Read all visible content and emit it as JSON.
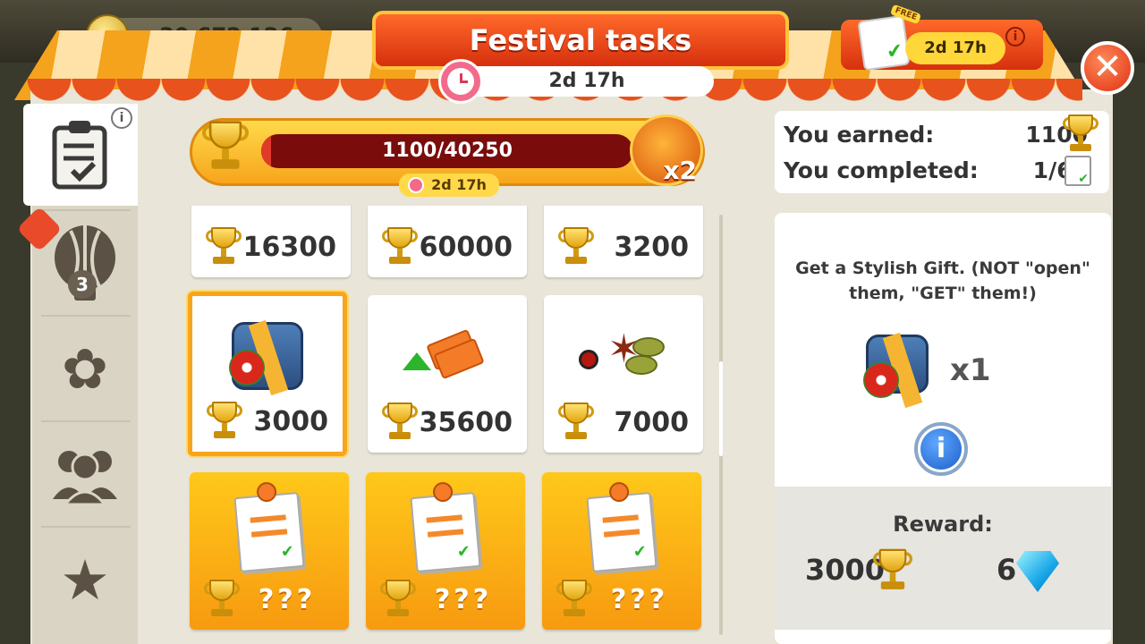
{
  "top_bar": {
    "coins": "30 672 126",
    "coin_icon": "coin-icon"
  },
  "header": {
    "title": "Festival tasks",
    "timer": "2d 17h"
  },
  "free_pass": {
    "badge": "FREE",
    "timer": "2d 17h",
    "info_icon": "info-icon",
    "close_icon": "close-icon"
  },
  "sidebar": {
    "tabs": [
      {
        "name": "tasks",
        "icon": "clipboard-icon",
        "glyph": "📋",
        "active": true,
        "info": "i"
      },
      {
        "name": "balloons",
        "icon": "balloon-icon",
        "glyph": "🎈",
        "badge": "3"
      },
      {
        "name": "flower",
        "icon": "pinwheel-icon",
        "glyph": "✿"
      },
      {
        "name": "friends",
        "icon": "people-icon",
        "glyph": "👥"
      },
      {
        "name": "rating",
        "icon": "star-wreath-icon",
        "glyph": "★"
      }
    ]
  },
  "progress": {
    "current": 1100,
    "goal": 40250,
    "text": "1100/40250",
    "timer": "2d 17h",
    "multiplier": "x2",
    "fill_fraction": 0.027
  },
  "tasks": {
    "rows": [
      [
        {
          "reward": "16300",
          "art": "none",
          "state": "normal"
        },
        {
          "reward": "60000",
          "art": "none",
          "state": "normal"
        },
        {
          "reward": "3200",
          "art": "none",
          "state": "normal"
        }
      ],
      [
        {
          "reward": "3000",
          "art": "stylish-gift",
          "state": "selected"
        },
        {
          "reward": "35600",
          "art": "tickets",
          "state": "normal"
        },
        {
          "reward": "7000",
          "art": "spices",
          "state": "normal"
        }
      ],
      [
        {
          "reward": "???",
          "art": "task-note",
          "state": "locked"
        },
        {
          "reward": "???",
          "art": "task-note",
          "state": "locked"
        },
        {
          "reward": "???",
          "art": "task-note",
          "state": "locked"
        }
      ]
    ]
  },
  "stats": {
    "earned_label": "You earned:",
    "earned_value": "1100",
    "completed_label": "You completed:",
    "completed_value": "1/60"
  },
  "detail": {
    "description": "Get a Stylish Gift. (NOT \"open\" them, \"GET\" them!)",
    "quantity": "x1",
    "info_label": "i",
    "reward_label": "Reward:",
    "reward_trophies": "3000",
    "reward_gems": "6"
  }
}
